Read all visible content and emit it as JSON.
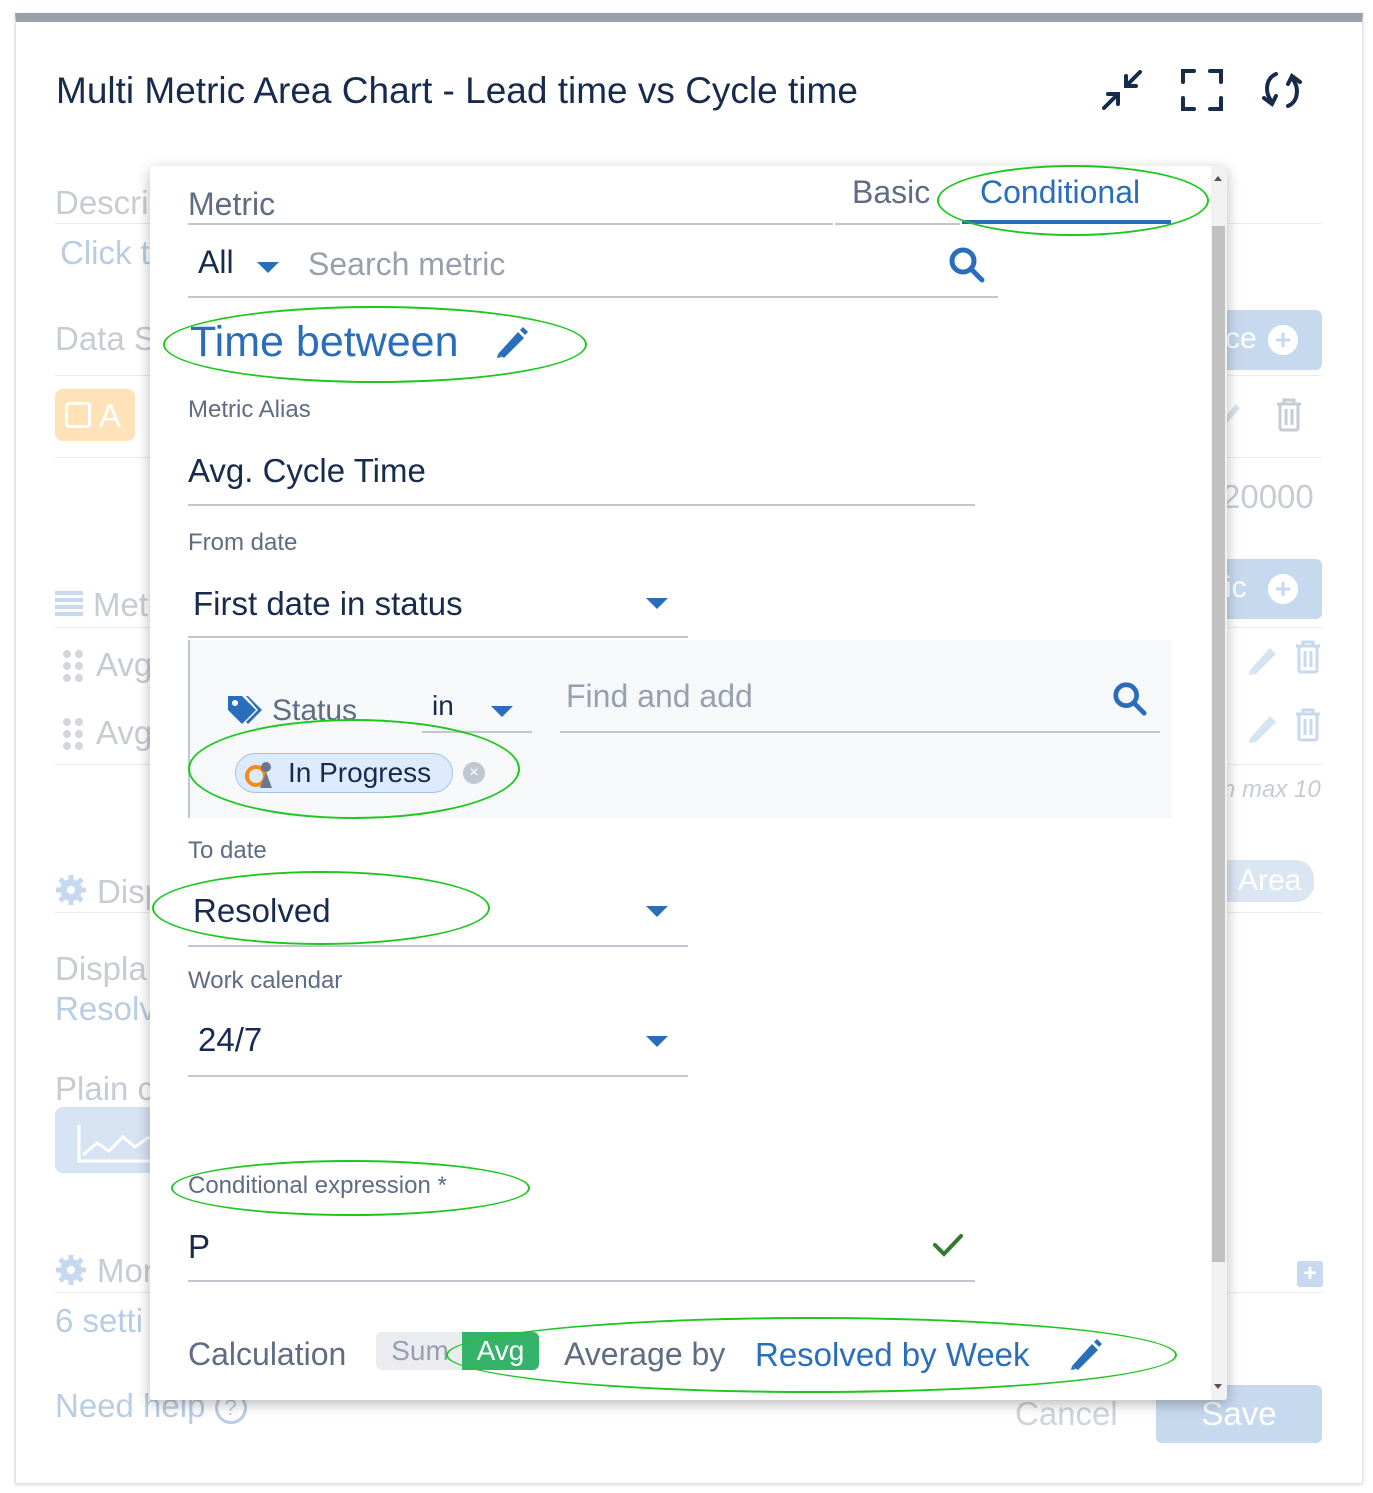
{
  "card": {
    "title": "Multi Metric Area Chart - Lead time vs Cycle time"
  },
  "background": {
    "description_label": "Descri",
    "click_link": "Click t",
    "data_source_label": "Data S",
    "add_source_button": "ce",
    "source_tag": "A",
    "max_value": "20000",
    "metrics_label": "Met",
    "add_metric_button": "ic",
    "metric_row_1": "Avg",
    "metric_row_2": "Avg",
    "max_note": "n max 10",
    "display_label": "Disp",
    "area_pill": "Area",
    "display_by_label": "Displa",
    "display_by_value": "Resolv",
    "plain_label": "Plain c",
    "more_label": "Mor",
    "settings_link": "6 setti",
    "need_help": "Need help",
    "cancel": "Cancel",
    "save": "Save"
  },
  "popup": {
    "metric_label": "Metric",
    "tab_basic": "Basic",
    "tab_conditional": "Conditional",
    "filter_select": "All",
    "search_placeholder": "Search metric",
    "metric_name": "Time between",
    "alias_label": "Metric Alias",
    "alias_value": "Avg. Cycle Time",
    "from_label": "From date",
    "from_value": "First date in status",
    "status_field": "Status",
    "status_operator": "in",
    "find_placeholder": "Find and add",
    "status_chip": "In Progress",
    "to_label": "To date",
    "to_value": "Resolved",
    "calendar_label": "Work calendar",
    "calendar_value": "24/7",
    "cond_expr_label": "Conditional expression *",
    "cond_expr_value": "P",
    "calc_label": "Calculation",
    "calc_sum": "Sum",
    "calc_avg": "Avg",
    "average_by_label": "Average by",
    "average_by_value": "Resolved by Week"
  },
  "colors": {
    "accent": "#2a6ebb",
    "avg_active": "#35b36b",
    "highlight_ellipse": "#1ec71e",
    "valid_check": "#2e7d32"
  }
}
